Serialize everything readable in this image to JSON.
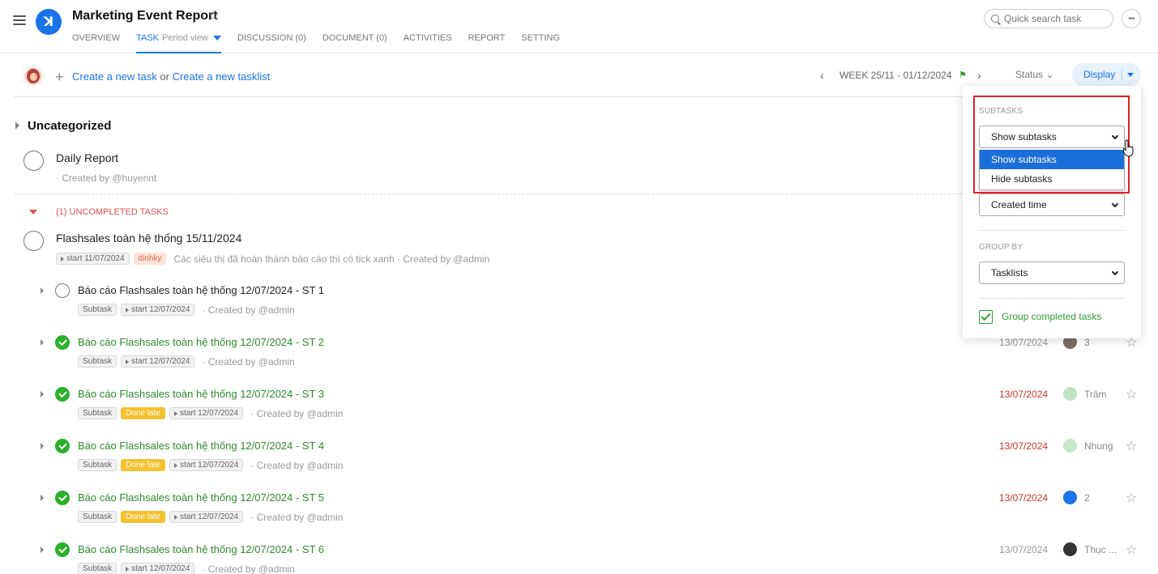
{
  "header": {
    "title": "Marketing Event Report",
    "tabs": [
      {
        "label": "OVERVIEW"
      },
      {
        "label": "TASK",
        "sub": "Period view"
      },
      {
        "label": "DISCUSSION (0)"
      },
      {
        "label": "DOCUMENT (0)"
      },
      {
        "label": "ACTIVITIES"
      },
      {
        "label": "REPORT"
      },
      {
        "label": "SETTING"
      }
    ],
    "search_placeholder": "Quick search task"
  },
  "actionbar": {
    "create_task": "Create a new task",
    "or": "or",
    "create_tasklist": "Create a new tasklist",
    "week": "WEEK 25/11 - 01/12/2024",
    "status": "Status",
    "display": "Display"
  },
  "section": {
    "title": "Uncategorized"
  },
  "daily_task": {
    "title": "Daily Report",
    "meta": "· Created by @huyennt"
  },
  "uncompleted_label": "(1) UNCOMPLETED TASKS",
  "parent_task": {
    "title": "Flashsales toàn hệ thống 15/11/2024",
    "start": "start 11/07/2024",
    "tag": "dinhky",
    "meta": "Các siêu thị đã hoàn thành báo cáo thì có tick xanh · Created by @admin"
  },
  "subtasks": [
    {
      "title": "Báo cáo Flashsales toàn hệ thống 12/07/2024 - ST 1",
      "done": false,
      "late": false,
      "tag": "Subtask",
      "start": "start 12/07/2024",
      "meta": "· Created by @admin",
      "due": "",
      "assignee": ""
    },
    {
      "title": "Báo cáo Flashsales toàn hệ thống 12/07/2024 - ST 2",
      "done": true,
      "late": false,
      "tag": "Subtask",
      "start": "start 12/07/2024",
      "meta": "· Created by @admin",
      "due": "13/07/2024",
      "assignee": "3"
    },
    {
      "title": "Báo cáo Flashsales toàn hệ thống 12/07/2024 - ST 3",
      "done": true,
      "late": true,
      "tag": "Subtask",
      "late_label": "Done late",
      "start": "start 12/07/2024",
      "meta": "· Created by @admin",
      "due": "13/07/2024",
      "assignee": "Trâm"
    },
    {
      "title": "Báo cáo Flashsales toàn hệ thống 12/07/2024 - ST 4",
      "done": true,
      "late": true,
      "tag": "Subtask",
      "late_label": "Done late",
      "start": "start 12/07/2024",
      "meta": "· Created by @admin",
      "due": "13/07/2024",
      "assignee": "Nhung"
    },
    {
      "title": "Báo cáo Flashsales toàn hệ thống 12/07/2024 - ST 5",
      "done": true,
      "late": true,
      "tag": "Subtask",
      "late_label": "Done late",
      "start": "start 12/07/2024",
      "meta": "· Created by @admin",
      "due": "13/07/2024",
      "assignee": "2"
    },
    {
      "title": "Báo cáo Flashsales toàn hệ thống 12/07/2024 - ST 6",
      "done": true,
      "late": false,
      "tag": "Subtask",
      "start": "start 12/07/2024",
      "meta": "· Created by @admin",
      "due": "13/07/2024",
      "assignee": "Thục ..."
    }
  ],
  "display_panel": {
    "subtasks_label": "SUBTASKS",
    "subtasks_value": "Show subtasks",
    "subtasks_options": [
      "Show subtasks",
      "Hide subtasks"
    ],
    "sort_value": "Created time",
    "group_label": "GROUP BY",
    "group_value": "Tasklists",
    "group_completed": "Group completed tasks"
  },
  "colors": {
    "accent": "#1a73e8",
    "done": "#2ab02a",
    "late": "#c0392b",
    "highlight": "#e0202a"
  }
}
